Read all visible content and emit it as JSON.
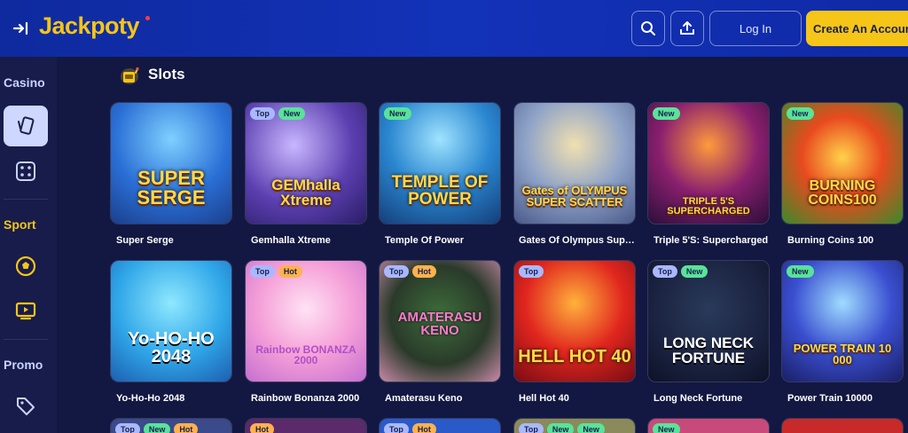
{
  "header": {
    "logo": "Jackpoty",
    "login_label": "Log In",
    "create_label": "Create An Account"
  },
  "colors": {
    "accent": "#f5c518",
    "header": "#1232b8",
    "background": "#131842",
    "badge_top": "#a9b8ff",
    "badge_new": "#59e39a",
    "badge_hot": "#ffb24d"
  },
  "sidebar": {
    "casino_label": "Casino",
    "sport_label": "Sport",
    "promo_label": "Promo",
    "icons": [
      "cards-icon",
      "dice-icon",
      "soccer-ball-icon",
      "live-tv-icon",
      "tag-icon"
    ]
  },
  "section": {
    "title": "Slots",
    "icon": "slot-machine-icon"
  },
  "games": [
    {
      "title": "Super Serge",
      "logo": "SUPER SERGE",
      "badges": []
    },
    {
      "title": "Gemhalla Xtreme",
      "logo": "GEMhalla Xtreme",
      "badges": [
        "Top",
        "New"
      ]
    },
    {
      "title": "Temple Of Power",
      "logo": "TEMPLE OF POWER",
      "badges": [
        "New"
      ]
    },
    {
      "title": "Gates Of Olympus Sup…",
      "logo": "Gates of OLYMPUS SUPER SCATTER",
      "badges": []
    },
    {
      "title": "Triple 5'S: Supercharged",
      "logo": "TRIPLE 5'S SUPERCHARGED",
      "badges": [
        "New"
      ]
    },
    {
      "title": "Burning Coins 100",
      "logo": "BURNING COINS100",
      "badges": [
        "New"
      ]
    },
    {
      "title": "Yo-Ho-Ho 2048",
      "logo": "Yo-HO-HO 2048",
      "badges": []
    },
    {
      "title": "Rainbow Bonanza 2000",
      "logo": "Rainbow BONANZA 2000",
      "badges": [
        "Top",
        "Hot"
      ]
    },
    {
      "title": "Amaterasu Keno",
      "logo": "AMATERASU KENO",
      "badges": [
        "Top",
        "Hot"
      ]
    },
    {
      "title": "Hell Hot 40",
      "logo": "HELL HOT 40",
      "badges": [
        "Top"
      ]
    },
    {
      "title": "Long Neck Fortune",
      "logo": "LONG NECK FORTUNE",
      "badges": [
        "Top",
        "New"
      ]
    },
    {
      "title": "Power Train 10000",
      "logo": "POWER TRAIN 10 000",
      "badges": [
        "New"
      ]
    }
  ],
  "next_row_badges": [
    [
      "Top",
      "New",
      "Hot"
    ],
    [
      "Hot"
    ],
    [
      "Top",
      "Hot"
    ],
    [
      "Top",
      "New",
      "New"
    ],
    [
      "New"
    ],
    []
  ]
}
